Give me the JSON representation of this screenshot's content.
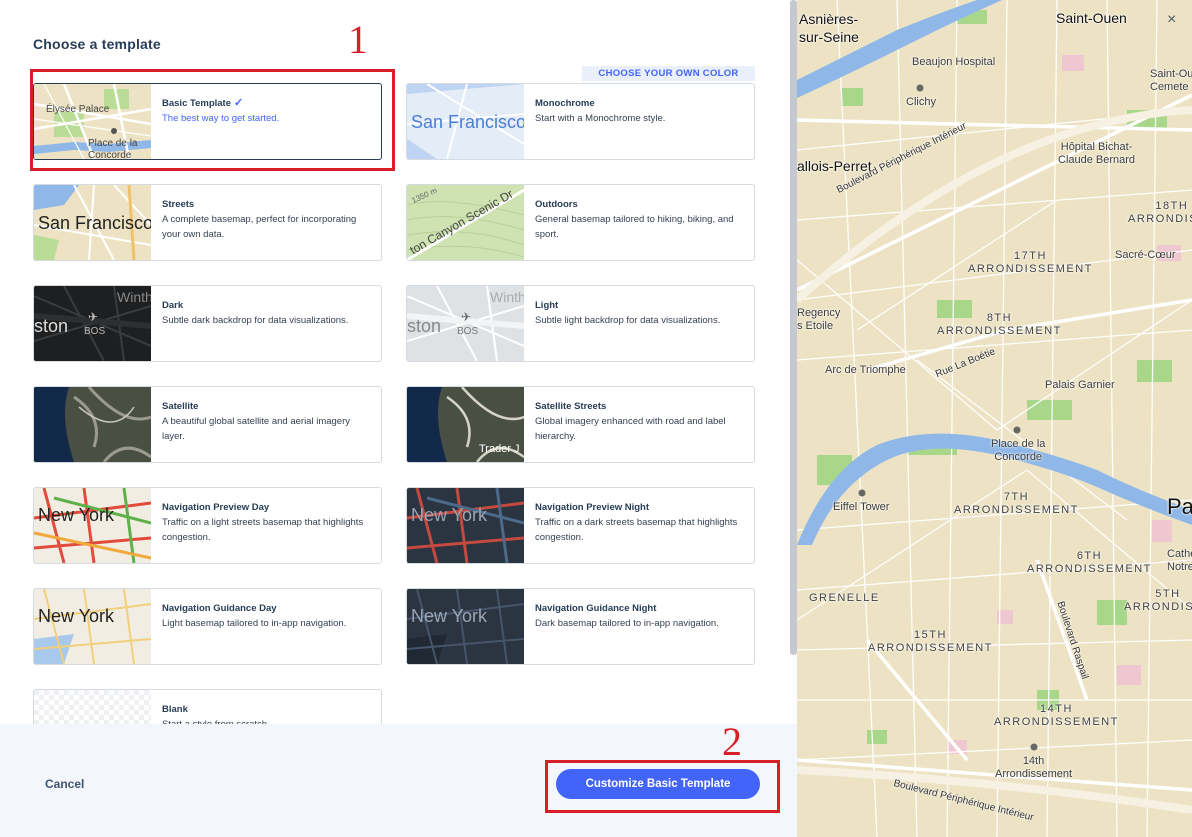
{
  "dialog": {
    "title": "Choose a template",
    "own_color_label": "CHOOSE YOUR OWN COLOR",
    "cancel_label": "Cancel",
    "customize_label": "Customize Basic Template"
  },
  "templates": [
    {
      "name": "Basic Template",
      "desc": "The best way to get started.",
      "selected": true,
      "thumb_text": [
        "Élysée Palace",
        "Place de la Concorde"
      ]
    },
    {
      "name": "Monochrome",
      "desc": "Start with a Monochrome style.",
      "thumb_text": [
        "San Francisco"
      ]
    },
    {
      "name": "Streets",
      "desc": "A complete basemap, perfect for incorporating your own data.",
      "thumb_text": [
        "San Francisco"
      ]
    },
    {
      "name": "Outdoors",
      "desc": "General basemap tailored to hiking, biking, and sport.",
      "thumb_text": [
        "ton Canyon Scenic Dr",
        "1350 m"
      ]
    },
    {
      "name": "Dark",
      "desc": "Subtle dark backdrop for data visualizations.",
      "thumb_text": [
        "ston",
        "BOS",
        "Winth"
      ]
    },
    {
      "name": "Light",
      "desc": "Subtle light backdrop for data visualizations.",
      "thumb_text": [
        "ston",
        "BOS",
        "Winth"
      ]
    },
    {
      "name": "Satellite",
      "desc": "A beautiful global satellite and aerial imagery layer."
    },
    {
      "name": "Satellite Streets",
      "desc": "Global imagery enhanced with road and label hierarchy.",
      "thumb_text": [
        "Trader J"
      ]
    },
    {
      "name": "Navigation Preview Day",
      "desc": "Traffic on a light streets basemap that highlights congestion.",
      "thumb_text": [
        "New York"
      ]
    },
    {
      "name": "Navigation Preview Night",
      "desc": "Traffic on a dark streets basemap that highlights congestion.",
      "thumb_text": [
        "New York"
      ]
    },
    {
      "name": "Navigation Guidance Day",
      "desc": "Light basemap tailored to in-app navigation.",
      "thumb_text": [
        "New York"
      ]
    },
    {
      "name": "Navigation Guidance Night",
      "desc": "Dark basemap tailored to in-app navigation.",
      "thumb_text": [
        "New York"
      ]
    },
    {
      "name": "Blank",
      "desc": "Start a style from scratch."
    }
  ],
  "annotations": [
    "1",
    "2"
  ],
  "map": {
    "close_icon": "×",
    "labels": {
      "asnieres": "Asnières-\nsur-Seine",
      "saint_ouen": "Saint-Ouen",
      "beaujon": "Beaujon Hospital",
      "clichy": "Clichy",
      "saint_ouen_cem": "Saint-Ou\nCemete",
      "bichat": "Hôpital Bichat-\nClaude Bernard",
      "levallois": "allois-Perret",
      "periph_north": "Boulevard Périphérique Intérieur",
      "arr18": "18TH\nARRONDISSE",
      "arr17": "17TH\nARRONDISSEMENT",
      "sacre_coeur": "Sacré-Cœur",
      "regency": "Regency\ns Etoile",
      "arr8": "8TH\nARRONDISSEMENT",
      "boetie": "Rue La Boétie",
      "arc": "Arc de Triomphe",
      "garnier": "Palais Garnier",
      "concorde": "Place de la\nConcorde",
      "eiffel": "Eiffel Tower",
      "arr7": "7TH\nARRONDISSEMENT",
      "paris": "Pa",
      "arr6": "6TH\nARRONDISSEMENT",
      "cathedral": "Cathed\nNotre D",
      "grenelle": "GRENELLE",
      "arr5": "5TH\nARRONDISSE",
      "raspail": "Boulevard Raspail",
      "arr15": "15TH\nARRONDISSEMENT",
      "arr14": "14TH\nARRONDISSEMENT",
      "arr14_poi": "14th\nArrondissement",
      "periph_south": "Boulevard Périphérique Intérieur"
    }
  },
  "colors": {
    "accent": "#4264fb",
    "annotation": "#d81f26",
    "map_land": "#ede3c4",
    "map_water": "#8fb8e8",
    "map_park": "#a8d78a"
  }
}
